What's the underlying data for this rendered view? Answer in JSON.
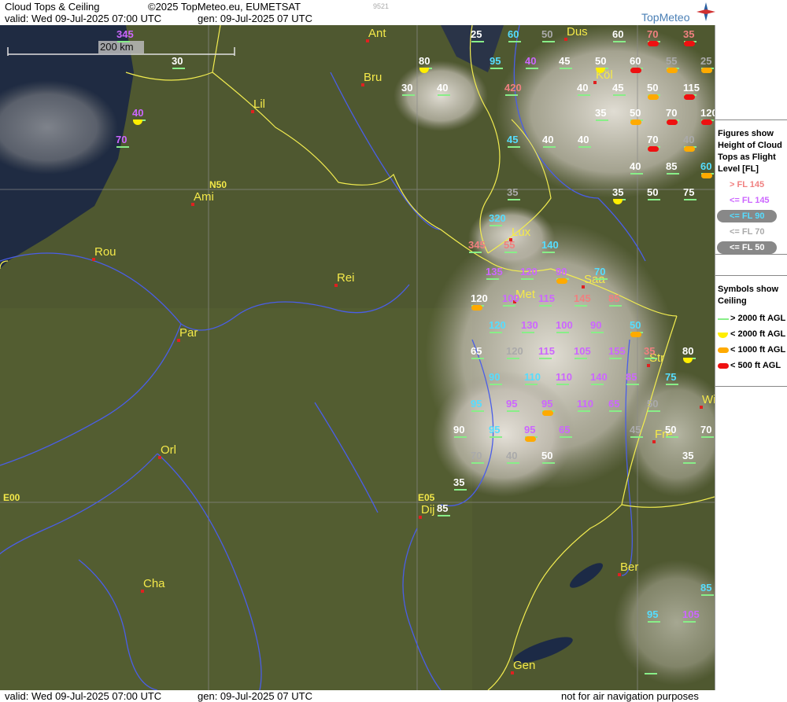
{
  "header": {
    "product": "Cloud Tops & Ceiling",
    "copyright": "©2025 TopMeteo.eu, EUMETSAT",
    "valid": "valid:  Wed  09-Jul-2025  07:00 UTC",
    "gen": "gen: 09-Jul-2025 07 UTC",
    "code": "9521",
    "brand": "TopMeteo"
  },
  "footer": {
    "valid": "valid:  Wed  09-Jul-2025  07:00 UTC",
    "gen": "gen: 09-Jul-2025 07 UTC",
    "disclaimer": "not for air navigation purposes"
  },
  "scale": "200 km",
  "grid_labels": [
    "N50",
    "E00",
    "E05"
  ],
  "legend_tops": {
    "title": "Figures show Height of Cloud Tops as Flight Level [FL]",
    "items": [
      {
        "text": "> FL 145",
        "color": "#f08080"
      },
      {
        "text": "<= FL 145",
        "color": "#cc66ff"
      },
      {
        "text": "<= FL 90",
        "color": "#55ddff"
      },
      {
        "text": "<= FL 70",
        "color": "#aaaaaa"
      },
      {
        "text": "<= FL 50",
        "color": "#ffffff"
      }
    ]
  },
  "legend_ceiling": {
    "title": "Symbols show Ceiling",
    "items": [
      {
        "text": "> 2000 ft AGL",
        "color": "#88ee88"
      },
      {
        "text": "< 2000 ft AGL",
        "color": "#ffee00"
      },
      {
        "text": "< 1000 ft AGL",
        "color": "#ffaa00"
      },
      {
        "text": "< 500 ft AGL",
        "color": "#ee1111"
      }
    ]
  },
  "cities": [
    "Ant",
    "Dus",
    "Bru",
    "Köl",
    "Lil",
    "Ami",
    "Lux",
    "Rou",
    "Rei",
    "Saa",
    "Met",
    "Par",
    "Str",
    "Fre",
    "Orl",
    "Dij",
    "Cha",
    "Ber",
    "Gen",
    "Wi"
  ],
  "figures": [
    "345",
    "25",
    "30",
    "60",
    "50",
    "60",
    "70",
    "35",
    "80",
    "95",
    "40",
    "45",
    "50",
    "60",
    "55",
    "25",
    "30",
    "40",
    "420",
    "40",
    "45",
    "50",
    "115",
    "40",
    "35",
    "50",
    "70",
    "120",
    "70",
    "45",
    "40",
    "40",
    "70",
    "40",
    "40",
    "85",
    "60",
    "35",
    "35",
    "50",
    "75",
    "320",
    "345",
    "55",
    "140",
    "135",
    "120",
    "90",
    "70",
    "120",
    "100",
    "115",
    "145",
    "85",
    "120",
    "130",
    "100",
    "90",
    "50",
    "65",
    "120",
    "115",
    "105",
    "155",
    "35",
    "80",
    "90",
    "110",
    "110",
    "140",
    "85",
    "75",
    "95",
    "95",
    "95",
    "110",
    "65",
    "50",
    "90",
    "95",
    "95",
    "65",
    "45",
    "50",
    "70",
    "70",
    "40",
    "50",
    "35",
    "35",
    "85",
    "85",
    "95",
    "105"
  ]
}
